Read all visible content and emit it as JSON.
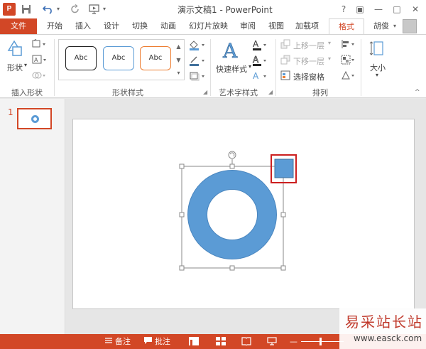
{
  "titlebar": {
    "app_icon": "P",
    "title": "演示文稿1 - PowerPoint",
    "help": "?",
    "ribbon_display": "▣",
    "minimize": "—",
    "restore": "□",
    "close": "✕"
  },
  "qat": {
    "save_icon": "save-icon",
    "undo_icon": "undo-icon",
    "redo_icon": "redo-icon",
    "present_icon": "from-beginning-icon"
  },
  "tabs": {
    "file": "文件",
    "items": [
      "开始",
      "插入",
      "设计",
      "切换",
      "动画",
      "幻灯片放映",
      "审阅",
      "视图",
      "加载项"
    ],
    "format": "格式",
    "user": "胡俊"
  },
  "ribbon": {
    "insert_shapes": {
      "shapes_label": "形状",
      "group_label": "插入形状"
    },
    "shape_styles": {
      "presets": [
        "Abc",
        "Abc",
        "Abc"
      ],
      "group_label": "形状样式"
    },
    "wordart": {
      "quick_styles_label": "快速样式",
      "group_label": "艺术字样式"
    },
    "arrange": {
      "bring_forward": "上移一层",
      "send_backward": "下移一层",
      "selection_pane": "选择窗格",
      "group_label": "排列"
    },
    "size": {
      "label": "大小"
    }
  },
  "thumbnails": {
    "slide_number": "1"
  },
  "statusbar": {
    "notes": "备注",
    "comments": "批注"
  },
  "colors": {
    "accent": "#d24726",
    "shape_fill": "#5b9bd5",
    "highlight": "#cc1f1f"
  },
  "watermark": {
    "text": "易采站长站",
    "url": "www.easck.com"
  }
}
